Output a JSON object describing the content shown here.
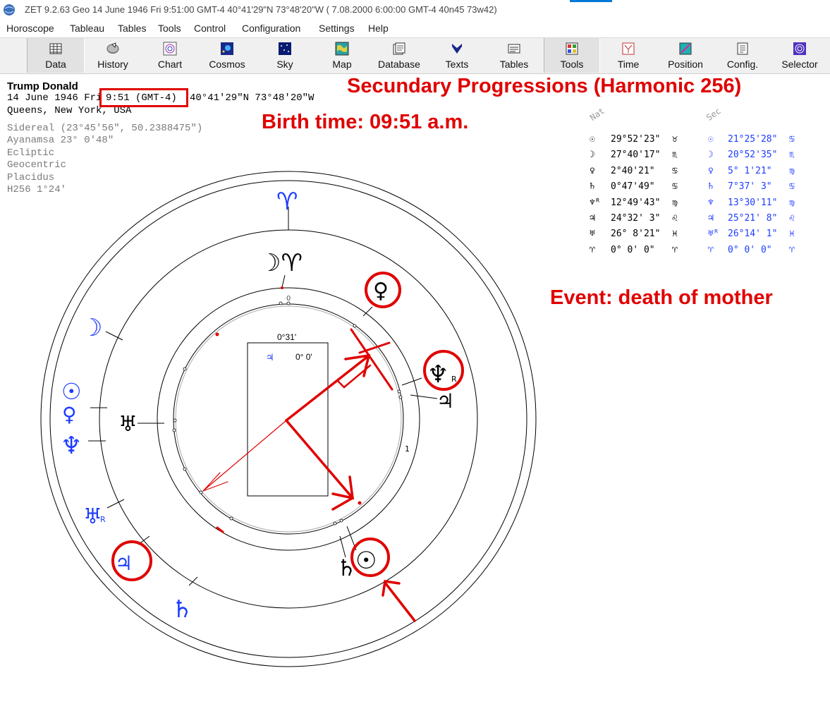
{
  "window": {
    "title": "ZET 9.2.63 Geo   14 June 1946  Fri   9:51:00 GMT-4 40°41'29\"N  73°48'20\"W  ( 7.08.2000   6:00:00 GMT-4 40n45 73w42)"
  },
  "menu": [
    "Horoscope",
    "Tableau",
    "Tables",
    "Tools",
    "Control",
    "Configuration",
    "Settings",
    "Help"
  ],
  "toolbar": [
    {
      "label": "Data",
      "icon": "data-grid-icon"
    },
    {
      "label": "History",
      "icon": "history-disc-icon"
    },
    {
      "label": "Chart",
      "icon": "chart-wheel-icon"
    },
    {
      "label": "Cosmos",
      "icon": "cosmos-icon"
    },
    {
      "label": "Sky",
      "icon": "sky-stars-icon"
    },
    {
      "label": "Map",
      "icon": "map-icon"
    },
    {
      "label": "Database",
      "icon": "database-icon"
    },
    {
      "label": "Texts",
      "icon": "texts-icon"
    },
    {
      "label": "Tables",
      "icon": "tables-icon"
    },
    {
      "label": "Tools",
      "icon": "tools-icon"
    },
    {
      "label": "Time",
      "icon": "time-icon"
    },
    {
      "label": "Position",
      "icon": "position-icon"
    },
    {
      "label": "Config.",
      "icon": "config-icon"
    },
    {
      "label": "Selector",
      "icon": "selector-icon"
    }
  ],
  "chart_info": {
    "name": "Trump Donald",
    "date_day": "14 June 1946  Fri",
    "time": "9:51 (GMT-4)",
    "coords": "40°41'29\"N  73°48'20\"W",
    "place": "Queens, New York, USA",
    "zodiac": "Sidereal (23°45'56\", 50.2388475\")",
    "ayanamsa": "Ayanamsa 23° 0'48\"",
    "plane": "Ecliptic",
    "center": "Geocentric",
    "houses": "Placidus",
    "harmonic": "H256   1°24'"
  },
  "annotations": {
    "title": "Secundary Progressions (Harmonic 256)",
    "birth_time": "Birth time: 09:51 a.m.",
    "event": "Event: death of mother"
  },
  "table": {
    "col_nat": "Nat",
    "col_sec": "Sec",
    "rows": [
      {
        "nat_glyph": "☉",
        "nat": "29°52'23\"",
        "nat_sign": "♉",
        "sec_glyph": "☉",
        "sec": "21°25'28\"",
        "sec_sign": "♋"
      },
      {
        "nat_glyph": "☽",
        "nat": "27°40'17\"",
        "nat_sign": "♏",
        "sec_glyph": "☽",
        "sec": "20°52'35\"",
        "sec_sign": "♏"
      },
      {
        "nat_glyph": "♀",
        "nat": " 2°40'21\"",
        "nat_sign": "♋",
        "sec_glyph": "♀",
        "sec": " 5° 1'21\"",
        "sec_sign": "♍"
      },
      {
        "nat_glyph": "♄",
        "nat": " 0°47'49\"",
        "nat_sign": "♋",
        "sec_glyph": "♄",
        "sec": " 7°37' 3\"",
        "sec_sign": "♋"
      },
      {
        "nat_glyph": "♆ᴿ",
        "nat": "12°49'43\"",
        "nat_sign": "♍",
        "sec_glyph": "♆",
        "sec": "13°30'11\"",
        "sec_sign": "♍"
      },
      {
        "nat_glyph": "♃",
        "nat": "24°32' 3\"",
        "nat_sign": "♌",
        "sec_glyph": "♃",
        "sec": "25°21' 8\"",
        "sec_sign": "♌"
      },
      {
        "nat_glyph": "♅",
        "nat": "26° 8'21\"",
        "nat_sign": "♓",
        "sec_glyph": "♅ᴿ",
        "sec": "26°14' 1\"",
        "sec_sign": "♓"
      },
      {
        "nat_glyph": "♈",
        "nat": " 0° 0' 0\"",
        "nat_sign": "♈",
        "sec_glyph": "♈",
        "sec": " 0° 0' 0\"",
        "sec_sign": "♈"
      }
    ]
  },
  "wheel": {
    "center_angle": "0°31'",
    "center_item_glyph": "♃",
    "center_item_value": "0° 0'",
    "mark_0": "0",
    "mark_1": "1",
    "retro_mark": "R",
    "outer_glyphs": {
      "aries_top": "♈",
      "moon": "☽",
      "sun": "☉",
      "venus": "♀",
      "neptune": "♆",
      "uranus": "♅",
      "jupiter": "♃",
      "saturn": "♄"
    },
    "inner_glyphs": {
      "moon_aries": "☽♈",
      "venus": "♀",
      "neptune": "♆",
      "jupiter": "♃",
      "uranus": "♅",
      "saturn": "♄",
      "sun": "☉"
    }
  },
  "colors": {
    "annotation_red": "#e00000",
    "progressed_blue": "#1e3cff",
    "toolbar_bg": "#f0f0f0"
  }
}
